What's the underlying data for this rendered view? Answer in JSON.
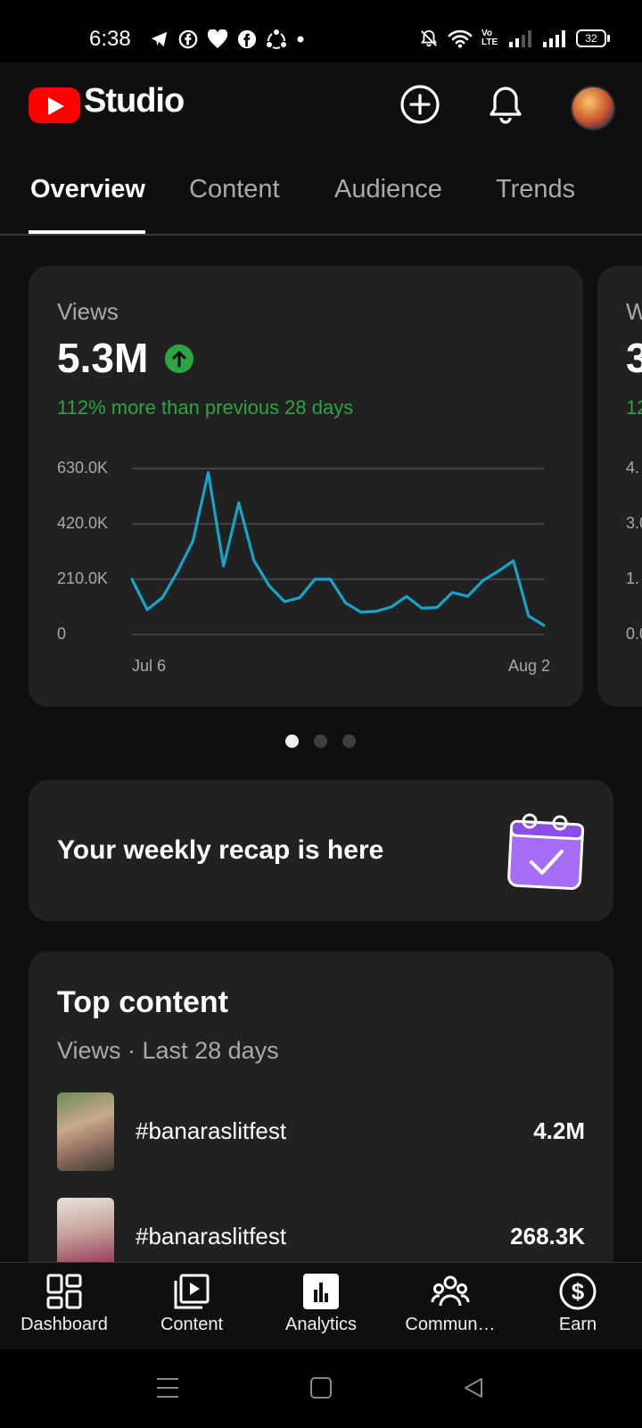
{
  "status_bar": {
    "time": "6:38",
    "lte_text": "Vo LTE",
    "battery": "32"
  },
  "header": {
    "logo_text": "Studio",
    "icons": [
      "add-circle-icon",
      "bell-icon",
      "avatar"
    ]
  },
  "tabs": [
    {
      "label": "Overview",
      "active": true
    },
    {
      "label": "Content",
      "active": false
    },
    {
      "label": "Audience",
      "active": false
    },
    {
      "label": "Trends",
      "active": false
    }
  ],
  "views_card": {
    "label": "Views",
    "value": "5.3M",
    "delta_text": "112% more than previous 28 days",
    "chart_data": {
      "type": "line",
      "x_start": "Jul 6",
      "x_end": "Aug 2",
      "x_tick_labels": [
        "Jul 6",
        "Aug 2"
      ],
      "y_tick_labels": [
        "630.0K",
        "420.0K",
        "210.0K",
        "0"
      ],
      "ylim": [
        0,
        630000
      ],
      "grid": true,
      "series": [
        {
          "values": [
            210000,
            95000,
            140000,
            240000,
            355000,
            615000,
            260000,
            500000,
            280000,
            185000,
            125000,
            140000,
            210000,
            210000,
            120000,
            85000,
            88000,
            105000,
            145000,
            100000,
            103000,
            160000,
            145000,
            205000,
            240000,
            280000,
            70000,
            35000
          ]
        }
      ]
    }
  },
  "next_card_peek": {
    "label": "W",
    "value": "3",
    "delta": "12",
    "y_tick_labels": [
      "4.",
      "3.0",
      "1.",
      "0.0"
    ]
  },
  "carousel": {
    "count": 3,
    "active_index": 0
  },
  "recap": {
    "text": "Your weekly recap is here"
  },
  "top_content": {
    "title": "Top content",
    "subtitle": "Views · Last 28 days",
    "rows": [
      {
        "title": "#banaraslitfest",
        "value": "4.2M"
      },
      {
        "title": "#banaraslitfest",
        "value": "268.3K"
      }
    ]
  },
  "bottom_nav": [
    {
      "label": "Dashboard",
      "icon": "dashboard-icon"
    },
    {
      "label": "Content",
      "icon": "content-icon"
    },
    {
      "label": "Analytics",
      "icon": "analytics-icon",
      "active": true
    },
    {
      "label": "Commun…",
      "icon": "community-icon"
    },
    {
      "label": "Earn",
      "icon": "earn-icon"
    }
  ],
  "colors": {
    "background": "#0f0f0f",
    "card": "#212121",
    "positive": "#2ba640",
    "chart_line": "#18a3c8",
    "brand_red": "#ff0000",
    "recap_accent": "#a56cf5"
  }
}
